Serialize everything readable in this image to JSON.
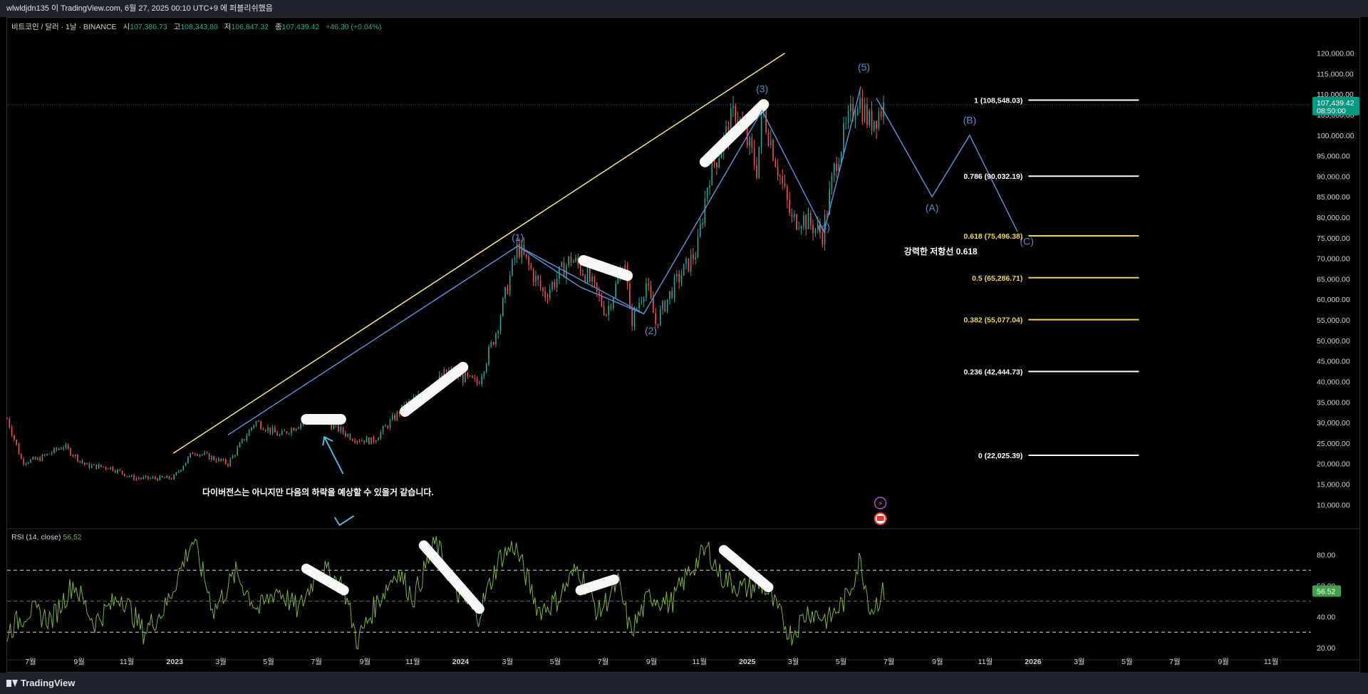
{
  "page": {
    "published_by": "wlwldjdn135 이 TradingView.com, 6월 27, 2025 00:10 UTC+9 에 퍼블리쉬했음",
    "footer_logo": "TradingView"
  },
  "legend": {
    "symbol": "비트코인 / 달러 · 1날 · BINANCE",
    "open_label": "시",
    "open": "107,386.73",
    "high_label": "고",
    "high": "108,343.80",
    "low_label": "저",
    "low": "106,847.32",
    "close_label": "종",
    "close": "107,439.42",
    "change": "+46.30 (+0.04%)"
  },
  "rsi_legend": {
    "label": "RSI (14, close)",
    "value": "56.52"
  },
  "colors": {
    "up": "#26a69a",
    "down": "#ef5350",
    "fib_white": "#ffffff",
    "fib_yellow": "#f0d35b",
    "wave": "#5b8bd0",
    "trendline": "#f7e77a",
    "rsi": "#7cb342",
    "arrow": "#4fb8d8"
  },
  "chart_data": {
    "type": "line",
    "price_axis": {
      "ticks": [
        10000,
        15000,
        20000,
        25000,
        30000,
        35000,
        40000,
        45000,
        50000,
        55000,
        60000,
        65000,
        70000,
        75000,
        80000,
        85000,
        90000,
        95000,
        100000,
        105000,
        110000,
        115000,
        120000
      ],
      "tick_labels": [
        "10,000.00",
        "15,000.00",
        "20,000.00",
        "25,000.00",
        "30,000.00",
        "35,000.00",
        "40,000.00",
        "45,000.00",
        "50,000.00",
        "55,000.00",
        "60,000.00",
        "65,000.00",
        "70,000.00",
        "75,000.00",
        "80,000.00",
        "85,000.00",
        "90,000.00",
        "95,000.00",
        "100,000.00",
        "105,000.00",
        "110,000.00",
        "115,000.00",
        "120,000.00"
      ],
      "range": [
        4500,
        126000
      ],
      "last_price_label": "107,439.42",
      "countdown_label": "08:50:00",
      "last_price": 107439.42
    },
    "time_axis": {
      "range": [
        "2022-06-01",
        "2026-12-20"
      ],
      "ticks": [
        "2022-07-01",
        "2022-09-01",
        "2022-11-01",
        "2023-01-01",
        "2023-03-01",
        "2023-05-01",
        "2023-07-01",
        "2023-09-01",
        "2023-11-01",
        "2024-01-01",
        "2024-03-01",
        "2024-05-01",
        "2024-07-01",
        "2024-09-01",
        "2024-11-01",
        "2025-01-01",
        "2025-03-01",
        "2025-05-01",
        "2025-07-01",
        "2025-09-01",
        "2025-11-01",
        "2026-01-01",
        "2026-03-01",
        "2026-05-01",
        "2026-07-01",
        "2026-09-01",
        "2026-11-01"
      ],
      "tick_labels": [
        "7월",
        "9월",
        "11월",
        "2023",
        "3월",
        "5월",
        "7월",
        "9월",
        "11월",
        "2024",
        "3월",
        "5월",
        "7월",
        "9월",
        "11월",
        "2025",
        "3월",
        "5월",
        "7월",
        "9월",
        "11월",
        "2026",
        "3월",
        "5월",
        "7월",
        "9월",
        "11월"
      ],
      "bold_labels": [
        "2023",
        "2024",
        "2025",
        "2026"
      ]
    },
    "price_series": {
      "name": "",
      "dates": [
        "2022-06-01",
        "2022-06-20",
        "2022-07-10",
        "2022-08-12",
        "2022-09-10",
        "2022-10-10",
        "2022-11-09",
        "2022-11-28",
        "2022-12-30",
        "2023-01-25",
        "2023-03-10",
        "2023-04-14",
        "2023-05-15",
        "2023-06-15",
        "2023-07-13",
        "2023-08-18",
        "2023-09-11",
        "2023-10-24",
        "2023-11-20",
        "2023-12-15",
        "2024-01-23",
        "2024-02-15",
        "2024-03-14",
        "2024-04-17",
        "2024-05-21",
        "2024-06-10",
        "2024-07-05",
        "2024-07-29",
        "2024-08-05",
        "2024-08-25",
        "2024-09-06",
        "2024-09-30",
        "2024-10-29",
        "2024-11-13",
        "2024-12-05",
        "2024-12-17",
        "2025-01-13",
        "2025-01-21",
        "2025-02-27",
        "2025-03-11",
        "2025-04-07",
        "2025-04-25",
        "2025-05-22",
        "2025-06-06",
        "2025-06-26"
      ],
      "close": [
        31000,
        20500,
        21000,
        24300,
        19500,
        19100,
        16500,
        16400,
        16500,
        23000,
        20000,
        30300,
        26800,
        30400,
        30200,
        26100,
        25500,
        34500,
        37500,
        42500,
        39500,
        52000,
        73000,
        61000,
        70000,
        66000,
        56800,
        69500,
        54000,
        64000,
        54200,
        63500,
        72000,
        90500,
        100000,
        106100,
        92000,
        106000,
        79000,
        80000,
        76000,
        94500,
        109500,
        103000,
        107439
      ]
    },
    "trendline": {
      "from": {
        "date": "2022-12-30",
        "price": 22500
      },
      "to": {
        "date": "2025-02-18",
        "price": 120000
      }
    },
    "wave_lines": [
      {
        "points": [
          {
            "date": "2023-03-10",
            "price": 27000
          },
          {
            "date": "2024-03-14",
            "price": 73000
          },
          {
            "date": "2024-08-22",
            "price": 56500
          },
          {
            "date": "2025-01-20",
            "price": 106000
          },
          {
            "date": "2025-04-09",
            "price": 76500
          },
          {
            "date": "2025-05-26",
            "price": 111800
          }
        ]
      },
      {
        "points": [
          {
            "date": "2025-06-15",
            "price": 109000
          },
          {
            "date": "2025-08-25",
            "price": 85000
          },
          {
            "date": "2025-10-12",
            "price": 100000
          },
          {
            "date": "2025-12-12",
            "price": 76500
          }
        ]
      },
      {
        "points": [
          {
            "date": "2024-03-14",
            "price": 73000
          },
          {
            "date": "2024-06-02",
            "price": 63000
          },
          {
            "date": "2024-08-22",
            "price": 56500
          }
        ]
      }
    ],
    "wave_labels": [
      {
        "text": "(1)",
        "date": "2024-03-14",
        "price": 74300
      },
      {
        "text": "(2)",
        "date": "2024-08-31",
        "price": 51500
      },
      {
        "text": "(3)",
        "date": "2025-01-20",
        "price": 110500
      },
      {
        "text": "(4)",
        "date": "2025-04-09",
        "price": 76800
      },
      {
        "text": "(5)",
        "date": "2025-05-30",
        "price": 115800
      },
      {
        "text": "(A)",
        "date": "2025-08-25",
        "price": 81500
      },
      {
        "text": "(B)",
        "date": "2025-10-12",
        "price": 102800
      },
      {
        "text": "(C)",
        "date": "2025-12-24",
        "price": 73300
      }
    ],
    "fib_levels": [
      {
        "label": "1 (108,548.03)",
        "value": 108548.03,
        "color": "#ffffff"
      },
      {
        "label": "0.786 (90,032.19)",
        "value": 90032.19,
        "color": "#ffffff"
      },
      {
        "label": "0.618 (75,496.38)",
        "value": 75496.38,
        "color": "#f0d35b"
      },
      {
        "label": "0.5 (65,286.71)",
        "value": 65286.71,
        "color": "#f0d35b"
      },
      {
        "label": "0.382 (55,077.04)",
        "value": 55077.04,
        "color": "#f0d35b"
      },
      {
        "label": "0.236 (42,444.73)",
        "value": 42444.73,
        "color": "#ffffff"
      },
      {
        "label": "0 (22,025.39)",
        "value": 22025.39,
        "color": "#ffffff"
      }
    ],
    "fib_range": [
      "2025-12-26",
      "2026-05-16"
    ],
    "annotations": [
      {
        "text": "강력한 저항선 0.618",
        "date": "2025-09-05",
        "price": 71000
      },
      {
        "text": "다이버전스는 아니지만 다음의 하락을 예상할 수 있을거 같습니다.",
        "date": "2023-07-03",
        "price": 12300
      }
    ],
    "highlights": [
      {
        "from": {
          "date": "2023-06-18",
          "price": 30800
        },
        "to": {
          "date": "2023-08-01",
          "price": 30800
        }
      },
      {
        "from": {
          "date": "2023-10-22",
          "price": 32700
        },
        "to": {
          "date": "2024-01-04",
          "price": 43500
        }
      },
      {
        "from": {
          "date": "2024-06-06",
          "price": 69500
        },
        "to": {
          "date": "2024-08-01",
          "price": 65800
        }
      },
      {
        "from": {
          "date": "2024-11-08",
          "price": 93500
        },
        "to": {
          "date": "2025-01-22",
          "price": 107500
        }
      }
    ],
    "rsi": {
      "ticks": [
        20,
        40,
        60,
        80
      ],
      "tick_labels": [
        "20.00",
        "40.00",
        "60.00",
        "80.00"
      ],
      "range": [
        14,
        94
      ],
      "bands": [
        70,
        50,
        30
      ],
      "current": 56.52,
      "current_label": "56.52",
      "dates": [
        "2022-06-01",
        "2022-06-28",
        "2022-07-28",
        "2022-08-25",
        "2022-09-20",
        "2022-10-25",
        "2022-11-22",
        "2022-12-20",
        "2023-01-24",
        "2023-02-20",
        "2023-03-20",
        "2023-04-18",
        "2023-05-12",
        "2023-06-08",
        "2023-07-05",
        "2023-08-04",
        "2023-08-22",
        "2023-09-15",
        "2023-10-12",
        "2023-11-02",
        "2023-11-30",
        "2023-12-27",
        "2024-01-23",
        "2024-02-20",
        "2024-03-10",
        "2024-04-10",
        "2024-05-02",
        "2024-05-30",
        "2024-06-25",
        "2024-07-20",
        "2024-08-05",
        "2024-08-30",
        "2024-09-25",
        "2024-10-20",
        "2024-11-12",
        "2024-11-28",
        "2024-12-25",
        "2025-01-22",
        "2025-02-26",
        "2025-03-20",
        "2025-04-15",
        "2025-05-08",
        "2025-05-25",
        "2025-06-08",
        "2025-06-26"
      ],
      "values": [
        30,
        44,
        38,
        62,
        36,
        54,
        30,
        46,
        90,
        44,
        68,
        44,
        58,
        44,
        72,
        60,
        24,
        48,
        70,
        52,
        88,
        56,
        40,
        78,
        86,
        44,
        50,
        72,
        42,
        62,
        30,
        54,
        48,
        70,
        84,
        66,
        58,
        60,
        28,
        44,
        38,
        52,
        77,
        44,
        57
      ]
    }
  },
  "rsi_highlights": [
    {
      "from": {
        "date": "2023-06-18",
        "value": 71
      },
      "to": {
        "date": "2023-08-05",
        "value": 57
      }
    },
    {
      "from": {
        "date": "2023-11-15",
        "value": 86
      },
      "to": {
        "date": "2024-01-25",
        "value": 45
      }
    },
    {
      "from": {
        "date": "2024-06-02",
        "value": 57
      },
      "to": {
        "date": "2024-07-15",
        "value": 64
      }
    },
    {
      "from": {
        "date": "2024-12-02",
        "value": 83
      },
      "to": {
        "date": "2025-01-28",
        "value": 59
      }
    }
  ],
  "arrows": [
    {
      "from": {
        "date": "2023-08-04",
        "price": 17500
      },
      "to": {
        "date": "2023-07-11",
        "price": 26500
      }
    }
  ]
}
